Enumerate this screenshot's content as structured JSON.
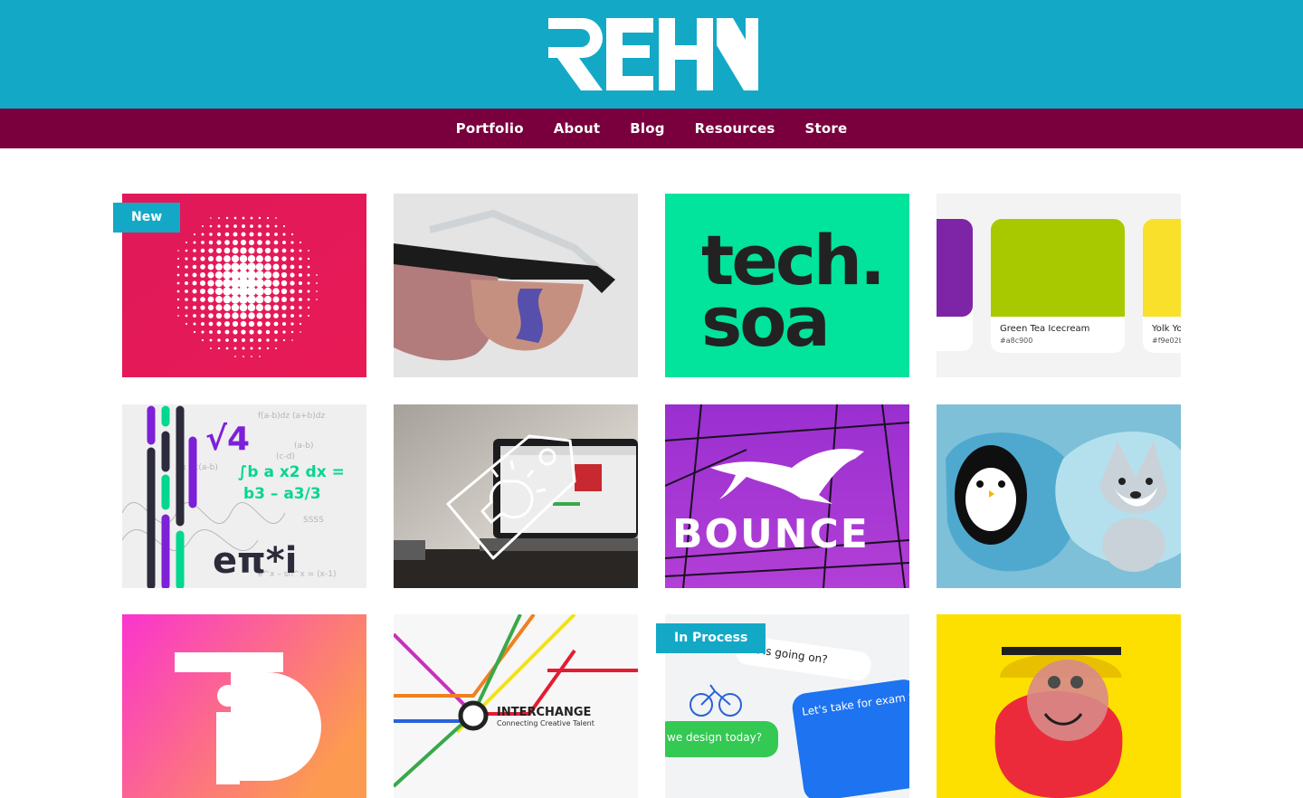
{
  "brand": {
    "name": "REHN",
    "header_color": "#13a9c6",
    "nav_color": "#79003c"
  },
  "nav": {
    "items": [
      {
        "label": "Portfolio"
      },
      {
        "label": "About"
      },
      {
        "label": "Blog"
      },
      {
        "label": "Resources"
      },
      {
        "label": "Store"
      }
    ]
  },
  "tiles": {
    "t1": {
      "badge": "New",
      "icon": "halftone-circle"
    },
    "t2": {
      "icon": "sunglasses"
    },
    "t3": {
      "line1": "tech.",
      "line2": "soa"
    },
    "t4": {
      "swatches": [
        {
          "name": "Green Tea Icecream",
          "hex": "#a8c900"
        },
        {
          "name": "Yolk Yo",
          "hex": "#f9e02b"
        }
      ]
    },
    "t5": {
      "formula1": "√4",
      "formula2": "∫b a x2 dx =",
      "formula3": "b3 – a3/3",
      "formula4": "eπ*i"
    },
    "t6": {
      "icon": "lightbulb-tag"
    },
    "t7": {
      "word": "BOUNCE",
      "icon": "kangaroo"
    },
    "t8": {
      "icon": "penguin-husky"
    },
    "t9": {
      "icon": "id-logo"
    },
    "t10": {
      "title": "INTERCHANGE",
      "subtitle": "Connecting Creative Talent"
    },
    "t11": {
      "badge": "In Process",
      "bubble1": "hat is going on?",
      "bubble2": "Let's take for exam team of designers designing a new a app. This",
      "bubble3": "we design today?"
    },
    "t12": {
      "icon": "red-character"
    }
  }
}
